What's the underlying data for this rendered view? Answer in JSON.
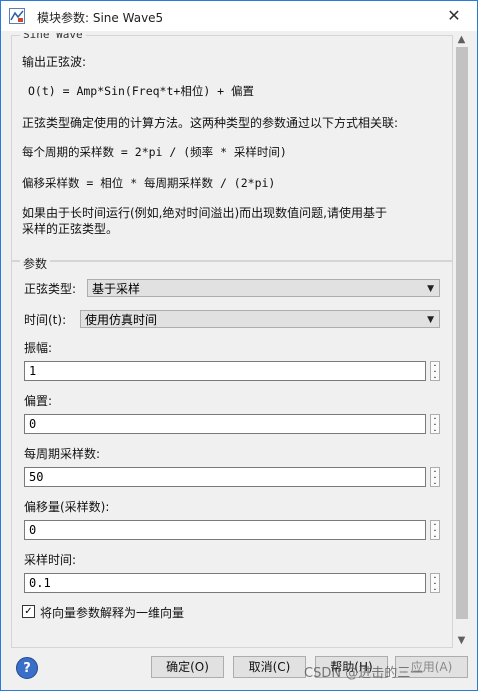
{
  "window": {
    "title": "模块参数: Sine Wave5",
    "close_glyph": "✕"
  },
  "description": {
    "legend": "Sine Wave",
    "lines": [
      "输出正弦波:",
      "O(t) = Amp*Sin(Freq*t+相位) + 偏置",
      "正弦类型确定使用的计算方法。这两种类型的参数通过以下方式相关联:",
      "每个周期的采样数 = 2*pi / (频率 * 采样时间)",
      "偏移采样数 = 相位 * 每周期采样数 / (2*pi)",
      "如果由于长时间运行(例如,绝对时间溢出)而出现数值问题,请使用基于",
      "采样的正弦类型。"
    ]
  },
  "params": {
    "legend": "参数",
    "sine_type": {
      "label": "正弦类型:",
      "value": "基于采样"
    },
    "time": {
      "label": "时间(t):",
      "value": "使用仿真时间"
    },
    "amplitude": {
      "label": "振幅:",
      "value": "1"
    },
    "bias": {
      "label": "偏置:",
      "value": "0"
    },
    "samples_per_period": {
      "label": "每周期采样数:",
      "value": "50"
    },
    "offset": {
      "label": "偏移量(采样数):",
      "value": "0"
    },
    "sample_time": {
      "label": "采样时间:",
      "value": "0.1"
    },
    "interpret_vector": {
      "label": "将向量参数解释为一维向量",
      "checked": true,
      "mark": "✓"
    }
  },
  "footer": {
    "help_glyph": "?",
    "ok": "确定(O)",
    "cancel": "取消(C)",
    "help": "帮助(H)",
    "apply": "应用(A)"
  },
  "watermark": "CSDN @进击的三一",
  "colors": {
    "title_border": "#2b79d8",
    "help_icon": "#3a6fc9"
  }
}
